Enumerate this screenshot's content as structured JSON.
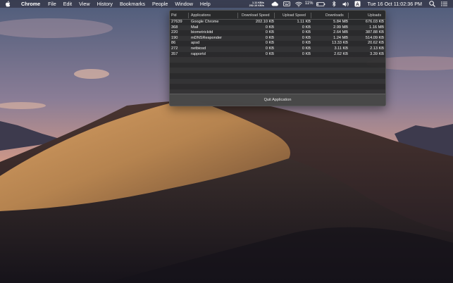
{
  "menubar": {
    "active_app": "Chrome",
    "menus": [
      "File",
      "Edit",
      "View",
      "History",
      "Bookmarks",
      "People",
      "Window",
      "Help"
    ],
    "net_up": "1.11 KB/s",
    "net_down": "202.10 KB/s",
    "battery_percent": "11%",
    "clock": "Tue 16 Oct  11:02:36 PM"
  },
  "table": {
    "headers": {
      "pid": "Pid",
      "application": "Applications",
      "download_speed": "Download Speed",
      "upload_speed": "Upload Speed",
      "downloads": "Downloads",
      "uploads": "Uploads"
    },
    "rows": [
      {
        "pid": "27639",
        "app": "Google Chrome",
        "download_speed": "202.10 KB",
        "upload_speed": "1.11 KB",
        "downloads": "5.84 MB",
        "uploads": "676.03 KB"
      },
      {
        "pid": "368",
        "app": "Mail",
        "download_speed": "0 KB",
        "upload_speed": "0 KB",
        "downloads": "2.99 MB",
        "uploads": "1.16 MB"
      },
      {
        "pid": "220",
        "app": "biometrickitd",
        "download_speed": "0 KB",
        "upload_speed": "0 KB",
        "downloads": "2.64 MB",
        "uploads": "387.88 KB"
      },
      {
        "pid": "190",
        "app": "mDNSResponder",
        "download_speed": "0 KB",
        "upload_speed": "0 KB",
        "downloads": "1.24 MB",
        "uploads": "514.09 KB"
      },
      {
        "pid": "86",
        "app": "apsd",
        "download_speed": "0 KB",
        "upload_speed": "0 KB",
        "downloads": "13.33 KB",
        "uploads": "20.62 KB"
      },
      {
        "pid": "272",
        "app": "netbiosd",
        "download_speed": "0 KB",
        "upload_speed": "0 KB",
        "downloads": "3.11 KB",
        "uploads": "2.13 KB"
      },
      {
        "pid": "357",
        "app": "rapportd",
        "download_speed": "0 KB",
        "upload_speed": "0 KB",
        "downloads": "2.62 KB",
        "uploads": "3.39 KB"
      }
    ],
    "empty_rows": 7
  },
  "quit_label": "Quit Application",
  "colors": {
    "menubar": "#2a2630",
    "popover_bg": "#262626",
    "sky_top": "#5a6a8a",
    "dune": "#b5834f"
  },
  "icons": [
    "apple-icon",
    "cloud-icon",
    "keyboard-icon",
    "wifi-icon",
    "battery-icon",
    "bluetooth-icon",
    "volume-icon",
    "user-icon",
    "search-icon",
    "list-icon"
  ]
}
